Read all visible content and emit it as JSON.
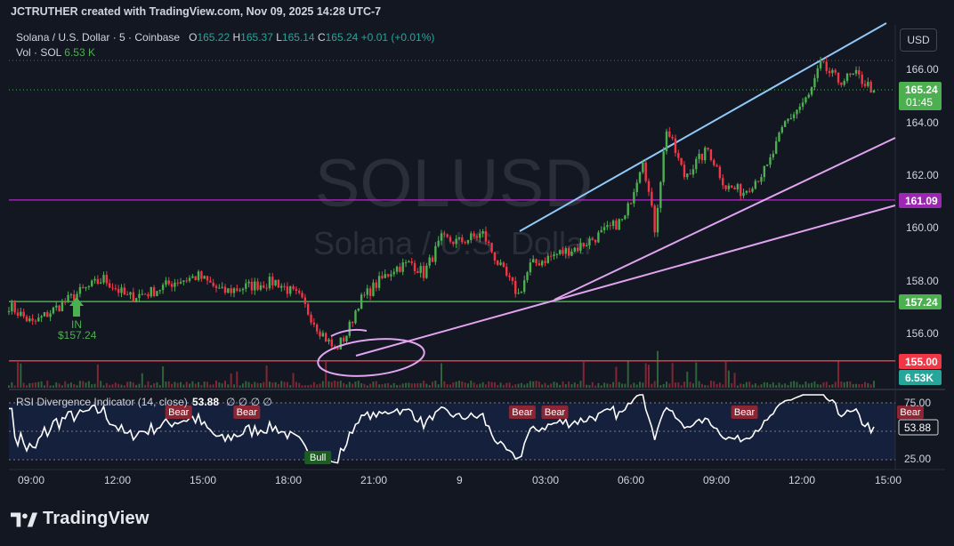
{
  "header": {
    "title": "JCTRUTHER created with TradingView.com, Nov 09, 2025 14:28 UTC-7"
  },
  "legend": {
    "symbol": "Solana / U.S. Dollar · 5 · Coinbase",
    "open_label": "O",
    "open": "165.22",
    "high_label": "H",
    "high": "165.37",
    "low_label": "L",
    "low": "165.14",
    "close_label": "C",
    "close": "165.24",
    "change": "+0.01 (+0.01%)",
    "vol_label": "Vol · SOL",
    "vol": "6.53 K"
  },
  "currency_button": "USD",
  "watermark": {
    "line1": "SOLUSD",
    "line2": "Solana / U.S. Dollar"
  },
  "price_axis": {
    "ticks": [
      "166.00",
      "164.00",
      "162.00",
      "160.00",
      "158.00",
      "156.00"
    ],
    "current_price": "165.24",
    "countdown": "01:45",
    "level_161": "161.09",
    "level_157": "157.24",
    "level_155": "155.00",
    "volume_badge": "6.53K"
  },
  "time_axis": {
    "ticks": [
      "09:00",
      "12:00",
      "15:00",
      "18:00",
      "21:00",
      "9",
      "03:00",
      "06:00",
      "09:00",
      "12:00",
      "15:00"
    ]
  },
  "annotations": {
    "in_label": "IN",
    "in_price": "$157.24"
  },
  "rsi": {
    "title": "RSI Divergence Indicator (14, close)",
    "value": "53.88",
    "placeholders": "∅ ∅ ∅ ∅",
    "ticks": [
      "75.00",
      "25.00"
    ],
    "bear_label": "Bear",
    "bull_label": "Bull"
  },
  "footer": {
    "brand": "TradingView"
  },
  "colors": {
    "background": "#131722",
    "up": "#4caf50",
    "down": "#f23645",
    "channel_blue": "#90caf9",
    "trend_pink": "#e1a4f0",
    "level_purple": "#9c27b0",
    "level_green": "#4caf50",
    "level_red": "#f23645"
  },
  "chart_data": [
    {
      "type": "line",
      "title": "SOLUSD",
      "series": [
        {
          "name": "SOLUSD",
          "approx_path": [
            [
              0,
              157.1
            ],
            [
              8,
              156.4
            ],
            [
              16,
              157.0
            ],
            [
              24,
              157.6
            ],
            [
              32,
              158.1
            ],
            [
              40,
              157.4
            ],
            [
              48,
              157.6
            ],
            [
              56,
              158.0
            ],
            [
              64,
              158.2
            ],
            [
              72,
              157.6
            ],
            [
              80,
              157.8
            ],
            [
              90,
              158.0
            ],
            [
              98,
              157.4
            ],
            [
              104,
              156.3
            ],
            [
              110,
              155.4
            ],
            [
              114,
              156.0
            ],
            [
              118,
              157.2
            ],
            [
              124,
              157.9
            ],
            [
              130,
              158.5
            ],
            [
              136,
              158.7
            ],
            [
              140,
              158.3
            ],
            [
              146,
              159.6
            ],
            [
              152,
              159.5
            ],
            [
              160,
              159.8
            ],
            [
              166,
              158.5
            ],
            [
              172,
              157.5
            ],
            [
              176,
              158.6
            ],
            [
              184,
              159.0
            ],
            [
              192,
              159.3
            ],
            [
              200,
              159.8
            ],
            [
              208,
              160.4
            ],
            [
              214,
              162.7
            ],
            [
              218,
              160.0
            ],
            [
              222,
              163.8
            ],
            [
              228,
              162.0
            ],
            [
              236,
              163.0
            ],
            [
              242,
              161.6
            ],
            [
              248,
              161.4
            ],
            [
              256,
              162.3
            ],
            [
              262,
              164.0
            ],
            [
              270,
              165.0
            ],
            [
              274,
              166.2
            ],
            [
              280,
              165.6
            ],
            [
              286,
              165.8
            ],
            [
              292,
              165.24
            ]
          ]
        }
      ],
      "x_unit": "5-minute bars",
      "ylim": [
        154.4,
        167.0
      ],
      "levels": [
        161.09,
        157.24,
        155.0
      ],
      "trendlines": "rising channel (blue upper line, pink lower lines)",
      "x_tick_labels": [
        "09:00",
        "12:00",
        "15:00",
        "18:00",
        "21:00",
        "9",
        "03:00",
        "06:00",
        "09:00",
        "12:00",
        "15:00"
      ]
    },
    {
      "type": "line",
      "title": "RSI Divergence Indicator (14, close)",
      "current": 53.88,
      "ylim": [
        20,
        82
      ],
      "bands": [
        75,
        25
      ],
      "divergences": [
        {
          "label": "Bear",
          "x": 57
        },
        {
          "label": "Bear",
          "x": 80
        },
        {
          "label": "Bull",
          "x": 104
        },
        {
          "label": "Bear",
          "x": 173
        },
        {
          "label": "Bear",
          "x": 184
        },
        {
          "label": "Bear",
          "x": 248
        },
        {
          "label": "Bear",
          "x": 304
        }
      ]
    }
  ]
}
